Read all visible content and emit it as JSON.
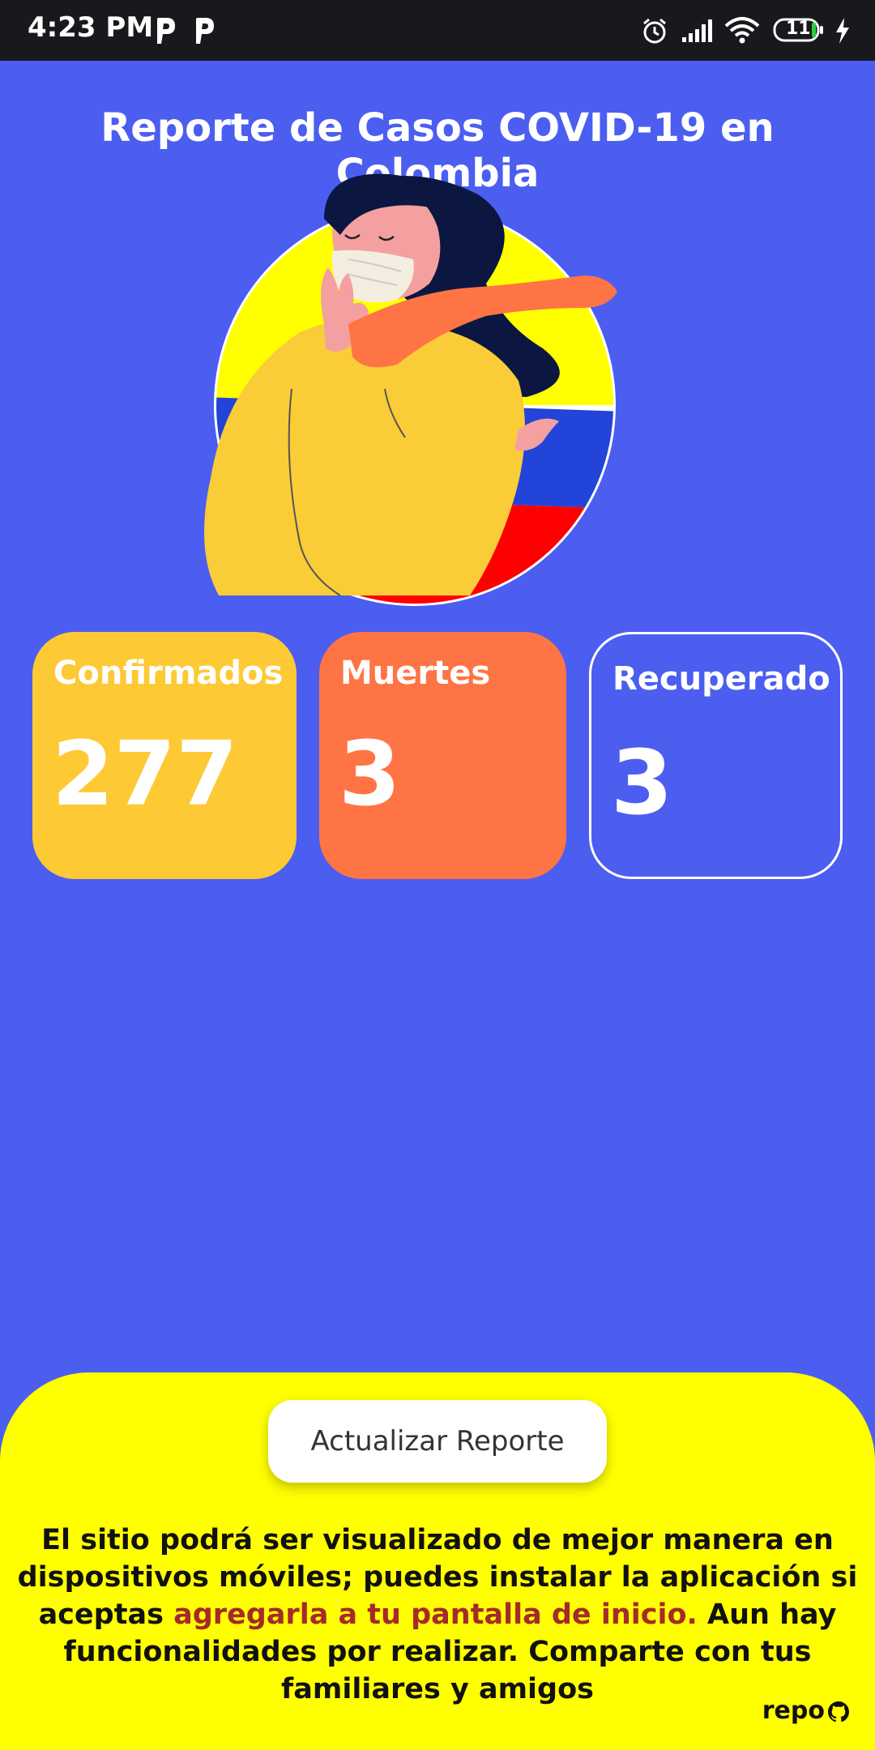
{
  "status_bar": {
    "time": "4:23 PM",
    "battery_level": "11",
    "icons": [
      "p-app-icon",
      "p-app-icon",
      "alarm-icon",
      "signal-icon",
      "wifi-icon",
      "battery-icon",
      "charging-icon"
    ]
  },
  "header": {
    "title": "Reporte de Casos COVID-19 en Colombia"
  },
  "stats": {
    "confirmed": {
      "label": "Confirmados",
      "value": "277"
    },
    "deaths": {
      "label": "Muertes",
      "value": "3"
    },
    "recovered": {
      "label": "Recuperado",
      "value": "3"
    }
  },
  "footer": {
    "button_label": "Actualizar Reporte",
    "info_before": "El sitio podrá ser visualizado de mejor manera en dispositivos móviles; puedes instalar la aplicación si aceptas ",
    "info_link": "agregarla a tu pantalla de inicio.",
    "info_after": " Aun hay funcionalidades por realizar. Comparte con tus familiares y amigos",
    "repo_label": "repo"
  },
  "colors": {
    "background": "#4B5EF0",
    "confirmed": "#FDC935",
    "deaths": "#FF7444",
    "panel": "#FFFF00",
    "link": "#A52A2A"
  }
}
